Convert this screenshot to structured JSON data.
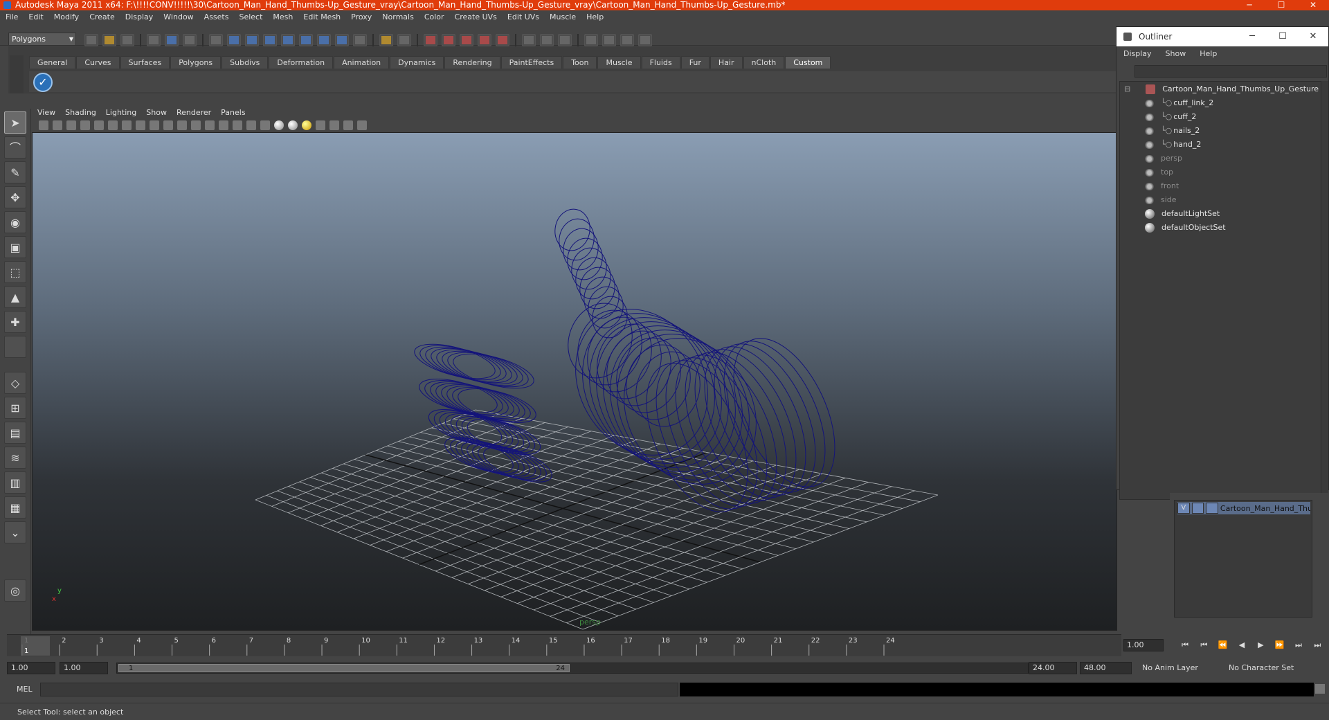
{
  "title": "Autodesk Maya 2011 x64: F:\\!!!!CONV!!!!!\\30\\Cartoon_Man_Hand_Thumbs-Up_Gesture_vray\\Cartoon_Man_Hand_Thumbs-Up_Gesture_vray\\Cartoon_Man_Hand_Thumbs-Up_Gesture.mb*",
  "window_buttons": {
    "minimize": "─",
    "maximize": "☐",
    "close": "✕"
  },
  "menu": [
    "File",
    "Edit",
    "Modify",
    "Create",
    "Display",
    "Window",
    "Assets",
    "Select",
    "Mesh",
    "Edit Mesh",
    "Proxy",
    "Normals",
    "Color",
    "Create UVs",
    "Edit UVs",
    "Muscle",
    "Help"
  ],
  "mode": "Polygons",
  "shelf_tabs": [
    "General",
    "Curves",
    "Surfaces",
    "Polygons",
    "Subdivs",
    "Deformation",
    "Animation",
    "Dynamics",
    "Rendering",
    "PaintEffects",
    "Toon",
    "Muscle",
    "Fluids",
    "Fur",
    "Hair",
    "nCloth",
    "Custom"
  ],
  "shelf_active": "Custom",
  "panel_menu": [
    "View",
    "Shading",
    "Lighting",
    "Show",
    "Renderer",
    "Panels"
  ],
  "viewport": {
    "camera": "persp",
    "axis_x": "x",
    "axis_y": "y",
    "wire_color": "#14147a",
    "grid_color": "#b0b4b8"
  },
  "outliner": {
    "title": "Outliner",
    "menu": [
      "Display",
      "Show",
      "Help"
    ],
    "root": "Cartoon_Man_Hand_Thumbs_Up_Gesture",
    "children": [
      "cuff_link_2",
      "cuff_2",
      "nails_2",
      "hand_2"
    ],
    "cameras": [
      "persp",
      "top",
      "front",
      "side"
    ],
    "sets": [
      "defaultLightSet",
      "defaultObjectSet"
    ]
  },
  "layer": {
    "visible": "V",
    "name": "Cartoon_Man_Hand_Thu"
  },
  "timeline": {
    "ticks": [
      "1",
      "2",
      "3",
      "4",
      "5",
      "6",
      "7",
      "8",
      "9",
      "10",
      "11",
      "12",
      "13",
      "14",
      "15",
      "16",
      "17",
      "18",
      "19",
      "20",
      "21",
      "22",
      "23",
      "24"
    ],
    "current_frame_label": "1",
    "current_frame": "1.00"
  },
  "playback_icons": [
    "⏮",
    "⏮",
    "⏪",
    "◀",
    "▶",
    "⏩",
    "⏭",
    "⏭"
  ],
  "range": {
    "start": "1.00",
    "anim_start": "1.00",
    "slider_start": "1",
    "slider_end": "24",
    "anim_end": "24.00",
    "end": "48.00",
    "anim_layer": "No Anim Layer",
    "char_set": "No Character Set"
  },
  "command": {
    "label": "MEL"
  },
  "help_line": "Select Tool: select an object"
}
